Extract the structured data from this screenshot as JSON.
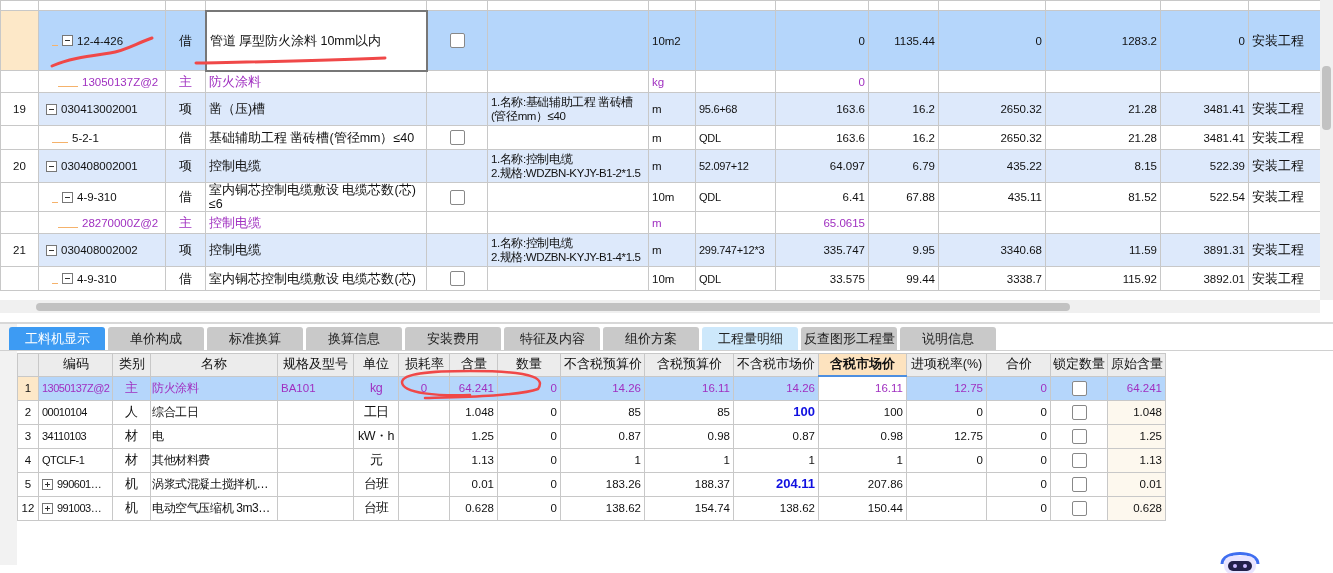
{
  "tree_rows": [
    {
      "kind": "de",
      "selected": true,
      "code": "12-4-426",
      "expanded": true,
      "category": "借",
      "name": "管道 厚型防火涂料 10mm以内",
      "checked": false,
      "unit": "10m2",
      "values": [
        "0",
        "1135.44",
        "0",
        "1283.2",
        "0"
      ],
      "specialty": "安装工程",
      "children": [
        {
          "kind": "main",
          "selected": false,
          "code": "13050137Z@2",
          "category": "主",
          "name": "防火涂料",
          "unit": "kg",
          "values": [
            "0"
          ]
        }
      ]
    },
    {
      "kind": "qd",
      "selected": false,
      "no": "19",
      "code": "030413002001",
      "expanded": true,
      "category": "项",
      "name": "凿（压)槽",
      "features": [
        "1.名称:基础辅助工程 凿砖槽(管径mm）≤40"
      ],
      "unit": "m",
      "expression": "95.6+68",
      "values": [
        "163.6",
        "16.2",
        "2650.32",
        "21.28",
        "3481.41"
      ],
      "specialty": "安装工程",
      "children": [
        {
          "kind": "de",
          "selected": false,
          "code": "5-2-1",
          "category": "借",
          "name": "基础辅助工程 凿砖槽(管径mm）≤40",
          "checked": false,
          "unit": "m",
          "expression": "QDL",
          "values": [
            "163.6",
            "16.2",
            "2650.32",
            "21.28",
            "3481.41"
          ],
          "specialty": "安装工程"
        }
      ]
    },
    {
      "kind": "qd",
      "selected": false,
      "no": "20",
      "code": "030408002001",
      "expanded": true,
      "category": "项",
      "name": "控制电缆",
      "features": [
        "1.名称:控制电缆",
        "2.规格:WDZBN-KYJY-B1-2*1.5"
      ],
      "unit": "m",
      "expression": "52.097+12",
      "values": [
        "64.097",
        "6.79",
        "435.22",
        "8.15",
        "522.39"
      ],
      "specialty": "安装工程",
      "children": [
        {
          "kind": "de",
          "selected": false,
          "code": "4-9-310",
          "expanded": true,
          "category": "借",
          "name": "室内铜芯控制电缆敷设 电缆芯数(芯) ≤6",
          "checked": false,
          "unit": "10m",
          "expression": "QDL",
          "values": [
            "6.41",
            "67.88",
            "435.11",
            "81.52",
            "522.54"
          ],
          "specialty": "安装工程",
          "children": [
            {
              "kind": "main",
              "selected": false,
              "code": "28270000Z@2",
              "category": "主",
              "name": "控制电缆",
              "unit": "m",
              "values": [
                "65.0615"
              ]
            }
          ]
        }
      ]
    },
    {
      "kind": "qd",
      "selected": false,
      "no": "21",
      "code": "030408002002",
      "expanded": true,
      "category": "项",
      "name": "控制电缆",
      "features": [
        "1.名称:控制电缆",
        "2.规格:WDZBN-KYJY-B1-4*1.5"
      ],
      "unit": "m",
      "expression": "299.747+12*3",
      "values": [
        "335.747",
        "9.95",
        "3340.68",
        "11.59",
        "3891.31"
      ],
      "specialty": "安装工程",
      "children": [
        {
          "kind": "de",
          "selected": false,
          "code": "4-9-310",
          "expanded": true,
          "category": "借",
          "name": "室内铜芯控制电缆敷设 电缆芯数(芯)",
          "checked": false,
          "unit": "10m",
          "expression": "QDL",
          "values": [
            "33.575",
            "99.44",
            "3338.7",
            "115.92",
            "3892.01"
          ],
          "specialty": "安装工程"
        }
      ]
    }
  ],
  "tabs": [
    {
      "label": "工料机显示",
      "selected": true,
      "highlighted": false
    },
    {
      "label": "单价构成",
      "selected": false,
      "highlighted": false
    },
    {
      "label": "标准换算",
      "selected": false,
      "highlighted": false
    },
    {
      "label": "换算信息",
      "selected": false,
      "highlighted": false
    },
    {
      "label": "安装费用",
      "selected": false,
      "highlighted": false
    },
    {
      "label": "特征及内容",
      "selected": false,
      "highlighted": false
    },
    {
      "label": "组价方案",
      "selected": false,
      "highlighted": false
    },
    {
      "label": "工程量明细",
      "selected": false,
      "highlighted": true
    },
    {
      "label": "反查图形工程量",
      "selected": false,
      "highlighted": false
    },
    {
      "label": "说明信息",
      "selected": false,
      "highlighted": false
    }
  ],
  "columns": [
    {
      "label": "编码",
      "selected": false
    },
    {
      "label": "类别",
      "selected": false
    },
    {
      "label": "名称",
      "selected": false
    },
    {
      "label": "规格及型号",
      "selected": false
    },
    {
      "label": "单位",
      "selected": false
    },
    {
      "label": "损耗率",
      "selected": false
    },
    {
      "label": "含量",
      "selected": false
    },
    {
      "label": "数量",
      "selected": false
    },
    {
      "label": "不含税预算价",
      "selected": false
    },
    {
      "label": "含税预算价",
      "selected": false
    },
    {
      "label": "不含税市场价",
      "selected": false
    },
    {
      "label": "含税市场价",
      "selected": true
    },
    {
      "label": "进项税率(%)",
      "selected": false
    },
    {
      "label": "合价",
      "selected": false
    },
    {
      "label": "锁定数量",
      "selected": false
    },
    {
      "label": "原始含量",
      "selected": false
    }
  ],
  "resources": [
    {
      "no": "1",
      "selected": true,
      "kind": "main",
      "code": "13050137Z@2",
      "category": "主",
      "name": "防火涂料",
      "spec": "BA101",
      "unit": "kg",
      "loss": "0",
      "content": "64.241",
      "quantity": "0",
      "prices": [
        "14.26",
        "16.11",
        "14.26",
        "16.11"
      ],
      "market_changed": false,
      "rate": "12.75",
      "total": "0",
      "locked": false,
      "original": "64.241"
    },
    {
      "no": "2",
      "selected": false,
      "kind": "plain",
      "code": "00010104",
      "category": "人",
      "name": "综合工日",
      "unit": "工日",
      "content": "1.048",
      "quantity": "0",
      "prices": [
        "85",
        "85",
        "100",
        "100"
      ],
      "market_changed": true,
      "rate": "0",
      "total": "0",
      "locked": false,
      "original": "1.048"
    },
    {
      "no": "3",
      "selected": false,
      "kind": "plain",
      "code": "34110103",
      "category": "材",
      "name": "电",
      "unit": "kW・h",
      "content": "1.25",
      "quantity": "0",
      "prices": [
        "0.87",
        "0.98",
        "0.87",
        "0.98"
      ],
      "market_changed": false,
      "rate": "12.75",
      "total": "0",
      "locked": false,
      "original": "1.25"
    },
    {
      "no": "4",
      "selected": false,
      "kind": "plain",
      "code": "QTCLF-1",
      "category": "材",
      "name": "其他材料费",
      "unit": "元",
      "content": "1.13",
      "quantity": "0",
      "prices": [
        "1",
        "1",
        "1",
        "1"
      ],
      "market_changed": false,
      "rate": "0",
      "total": "0",
      "locked": false,
      "original": "1.13"
    },
    {
      "no": "5",
      "selected": false,
      "kind": "plain",
      "expanded": false,
      "code": "990601…",
      "category": "机",
      "name": "涡浆式混凝土搅拌机…",
      "unit": "台班",
      "content": "0.01",
      "quantity": "0",
      "prices": [
        "183.26",
        "188.37",
        "204.11",
        "207.86"
      ],
      "market_changed": true,
      "total": "0",
      "locked": false,
      "original": "0.01"
    },
    {
      "no": "12",
      "selected": false,
      "kind": "plain",
      "expanded": false,
      "code": "991003…",
      "category": "机",
      "name": "电动空气压缩机 3m3…",
      "unit": "台班",
      "content": "0.628",
      "quantity": "0",
      "prices": [
        "138.62",
        "154.74",
        "138.62",
        "150.44"
      ],
      "market_changed": false,
      "total": "0",
      "locked": false,
      "original": "0.628"
    }
  ]
}
